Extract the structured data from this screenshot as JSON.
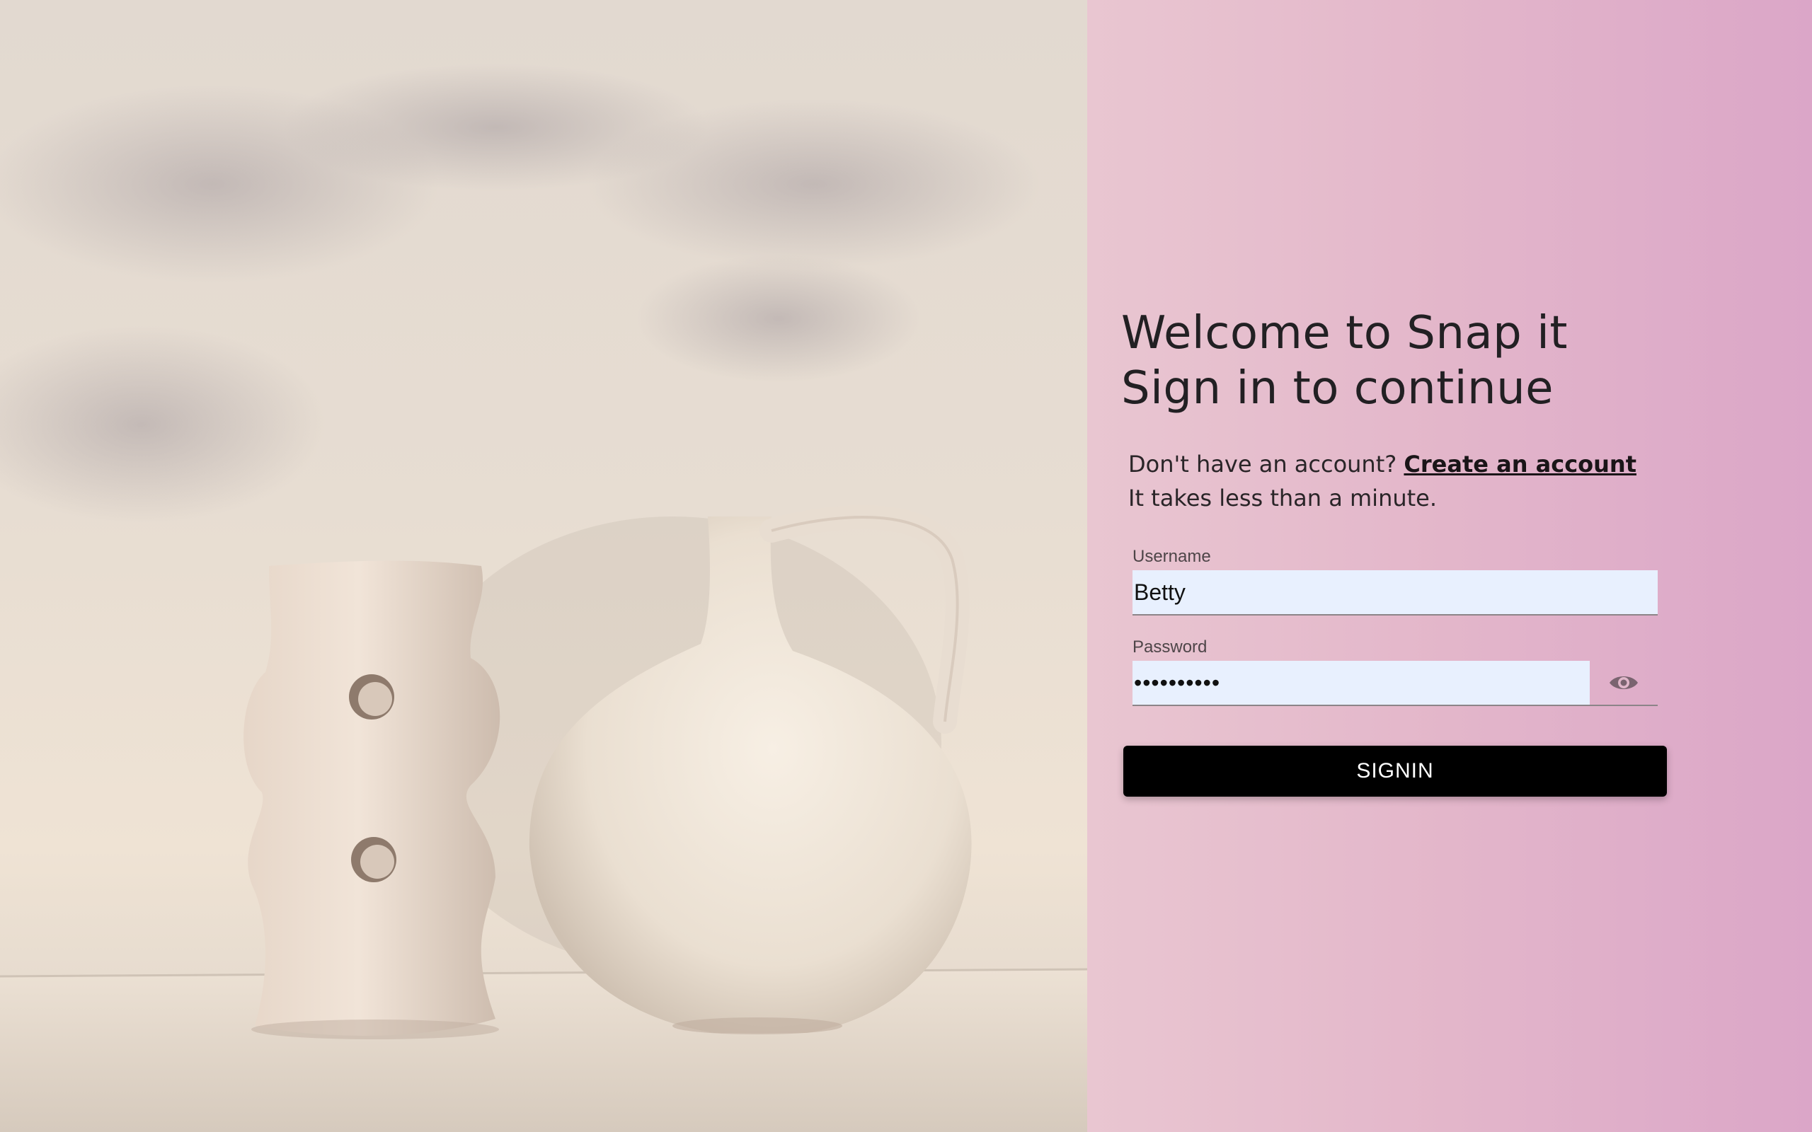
{
  "heading": {
    "line1": "Welcome to Snap it",
    "line2": "Sign in to continue"
  },
  "signup": {
    "prompt": "Don't have an account?",
    "link": "Create an account",
    "note": "It takes less than a minute."
  },
  "form": {
    "username_label": "Username",
    "username_value": "Betty",
    "password_label": "Password",
    "password_value": "••••••••••",
    "signin_label": "SIGNIN"
  },
  "icons": {
    "toggle_password": "eye-icon"
  },
  "colors": {
    "panel_start": "#e9c6d1",
    "panel_end": "#dba6c8",
    "input_bg": "#e8f0fe",
    "button_bg": "#000000",
    "button_text": "#ffffff"
  }
}
